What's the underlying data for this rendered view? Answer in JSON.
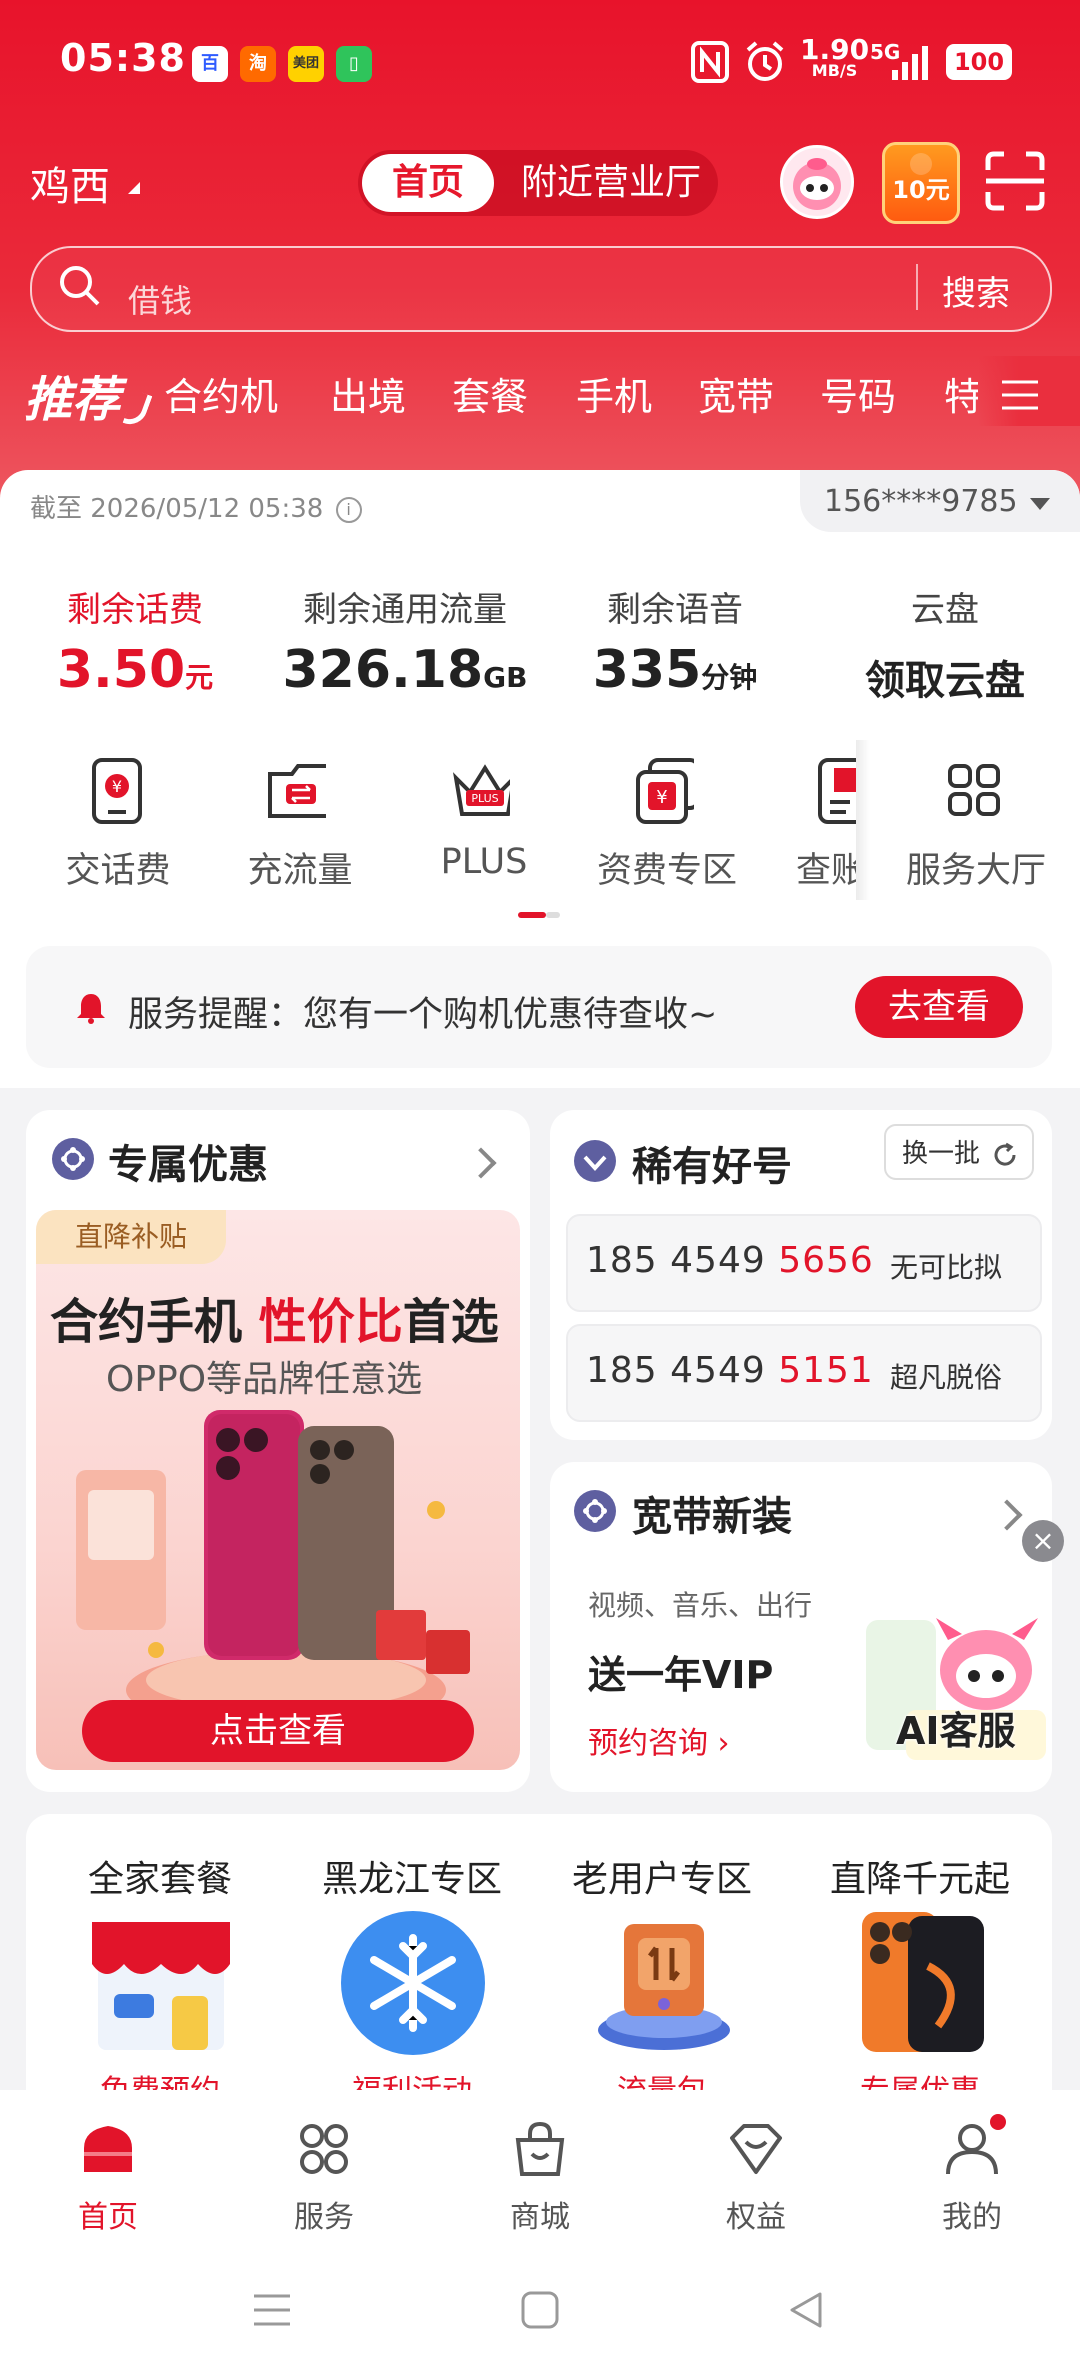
{
  "status_bar": {
    "time": "05:38",
    "apps": [
      "baidu-icon",
      "taobao-icon",
      "meituan-icon",
      "battery-app-icon"
    ],
    "app_texts": [
      "百",
      "淘",
      "美团",
      "▯"
    ],
    "network_speed": "1.90",
    "speed_unit": "MB/S",
    "network": "5G",
    "battery": "100"
  },
  "header": {
    "city": "鸡西",
    "tabs": [
      "首页",
      "附近营业厅"
    ],
    "coupon_label": "10元",
    "search_placeholder": "借钱",
    "search_button": "搜索",
    "categories": [
      "推荐",
      "合约机",
      "出境",
      "套餐",
      "手机",
      "宽带",
      "号码",
      "特"
    ]
  },
  "account": {
    "as_of": "截至 2026/05/12 05:38",
    "phone": "156****9785",
    "metrics": [
      {
        "label": "剩余话费",
        "value": "3.50",
        "unit": "元",
        "accent": true
      },
      {
        "label": "剩余通用流量",
        "value": "326.18",
        "unit": "GB"
      },
      {
        "label": "剩余语音",
        "value": "335",
        "unit": "分钟"
      },
      {
        "label": "云盘",
        "value": "领取云盘",
        "unit": ""
      }
    ],
    "quick_actions": [
      "交话费",
      "充流量",
      "PLUS",
      "资费专区",
      "查账",
      "服务大厅"
    ],
    "plus_badge": "PLUS",
    "notice_text": "服务提醒：您有一个购机优惠待查收~",
    "notice_button": "去查看"
  },
  "exclusive": {
    "title": "专属优惠",
    "tag": "直降补贴",
    "headline_a": "合约手机 ",
    "headline_hl": "性价比",
    "headline_b": "首选",
    "subline": "OPPO等品牌任意选",
    "button": "点击查看"
  },
  "rare_numbers": {
    "title": "稀有好号",
    "refresh": "换一批",
    "items": [
      {
        "prefix": "185 4549 ",
        "tail": "5656",
        "tag": "无可比拟"
      },
      {
        "prefix": "185 4549 ",
        "tail": "5151",
        "tag": "超凡脱俗"
      }
    ]
  },
  "broadband": {
    "title": "宽带新装",
    "subtitle": "视频、音乐、出行",
    "main": "送一年VIP",
    "link": "预约咨询",
    "ai_label": "AI客服",
    "close": "×"
  },
  "grid": {
    "items": [
      {
        "title": "全家套餐",
        "sub": "免费预约"
      },
      {
        "title": "黑龙江专区",
        "sub": "福利活动"
      },
      {
        "title": "老用户专区",
        "sub": "流量包"
      },
      {
        "title": "直降千元起",
        "sub": "专属优惠"
      }
    ]
  },
  "bottom_nav": {
    "items": [
      "首页",
      "服务",
      "商城",
      "权益",
      "我的"
    ]
  },
  "colors": {
    "brand_red": "#e2142a",
    "header_top": "#e8132b"
  }
}
